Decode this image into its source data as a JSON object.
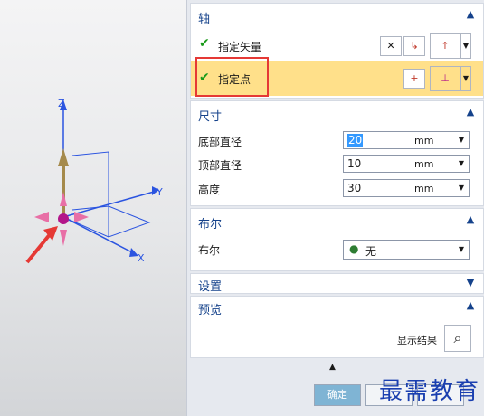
{
  "axis_section": {
    "title": "轴",
    "vector_label": "指定矢量",
    "point_label": "指定点"
  },
  "dimensions_section": {
    "title": "尺寸",
    "rows": [
      {
        "label": "底部直径",
        "value": "20",
        "unit": "mm"
      },
      {
        "label": "顶部直径",
        "value": "10",
        "unit": "mm"
      },
      {
        "label": "高度",
        "value": "30",
        "unit": "mm"
      }
    ]
  },
  "boolean_section": {
    "title": "布尔",
    "label": "布尔",
    "value": "无"
  },
  "settings_section": {
    "title": "设置"
  },
  "preview_section": {
    "title": "预览",
    "show_result_label": "显示结果"
  },
  "footer": {
    "ok_label": "确定"
  },
  "viewport": {
    "triad_labels": {
      "z": "Z",
      "y": "Y",
      "x": "X"
    }
  },
  "watermark": "最需教育",
  "colors": {
    "highlight_row": "#ffe08a",
    "annotation_red": "#e53935",
    "header_text": "#15428b",
    "ok_button": "#7fb4d4"
  }
}
